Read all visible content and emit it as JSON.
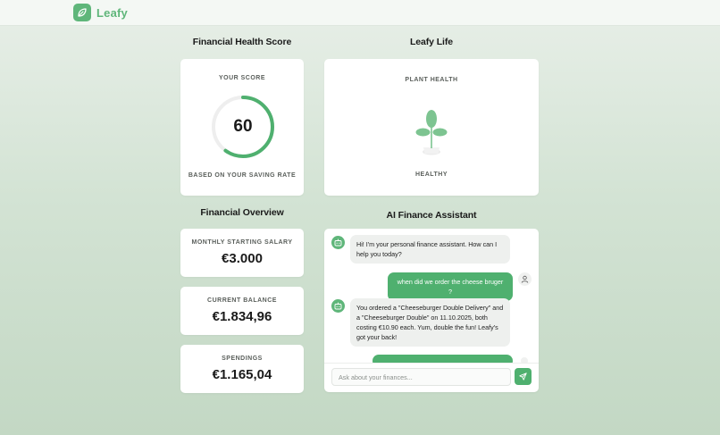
{
  "brand": {
    "name": "Leafy",
    "color": "#5fb67a"
  },
  "score_section": {
    "title": "Financial Health Score",
    "label": "YOUR SCORE",
    "value": "60",
    "score_percent": 60,
    "caption": "BASED ON YOUR SAVING RATE"
  },
  "life_section": {
    "title": "Leafy Life",
    "label": "PLANT HEALTH",
    "status": "HEALTHY"
  },
  "overview_section": {
    "title": "Financial Overview",
    "items": [
      {
        "label": "MONTHLY STARTING SALARY",
        "value": "€3.000"
      },
      {
        "label": "CURRENT BALANCE",
        "value": "€1.834,96"
      },
      {
        "label": "SPENDINGS",
        "value": "€1.165,04"
      }
    ]
  },
  "assistant": {
    "title": "AI Finance Assistant",
    "messages": [
      {
        "role": "bot",
        "lines": [
          "Hi! I'm your personal finance assistant. How can I",
          "help you today?"
        ]
      },
      {
        "role": "user",
        "text": "when did we order the cheese bruger ?"
      },
      {
        "role": "bot",
        "lines": [
          "You ordered a \"Cheeseburger Double Delivery\" and",
          "a \"Cheeseburger Double\" on 11.10.2025, both",
          "costing €10.90 each. Yum, double the fun! Leafy's",
          "got your back!"
        ]
      }
    ],
    "input_placeholder": "Ask about your finances..."
  },
  "colors": {
    "accent": "#4fb06f",
    "plant": "#7dc491"
  }
}
